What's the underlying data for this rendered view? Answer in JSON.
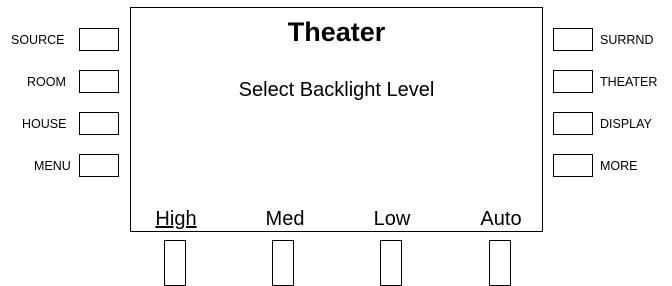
{
  "left_buttons": [
    {
      "label": "SOURCE"
    },
    {
      "label": "ROOM"
    },
    {
      "label": "HOUSE"
    },
    {
      "label": "MENU"
    }
  ],
  "right_buttons": [
    {
      "label": "SURRND"
    },
    {
      "label": "THEATER"
    },
    {
      "label": "DISPLAY"
    },
    {
      "label": "MORE"
    }
  ],
  "screen": {
    "title": "Theater",
    "message": "Select Backlight Level",
    "options": [
      {
        "label": "High",
        "selected": true
      },
      {
        "label": "Med",
        "selected": false
      },
      {
        "label": "Low",
        "selected": false
      },
      {
        "label": "Auto",
        "selected": false
      }
    ]
  }
}
